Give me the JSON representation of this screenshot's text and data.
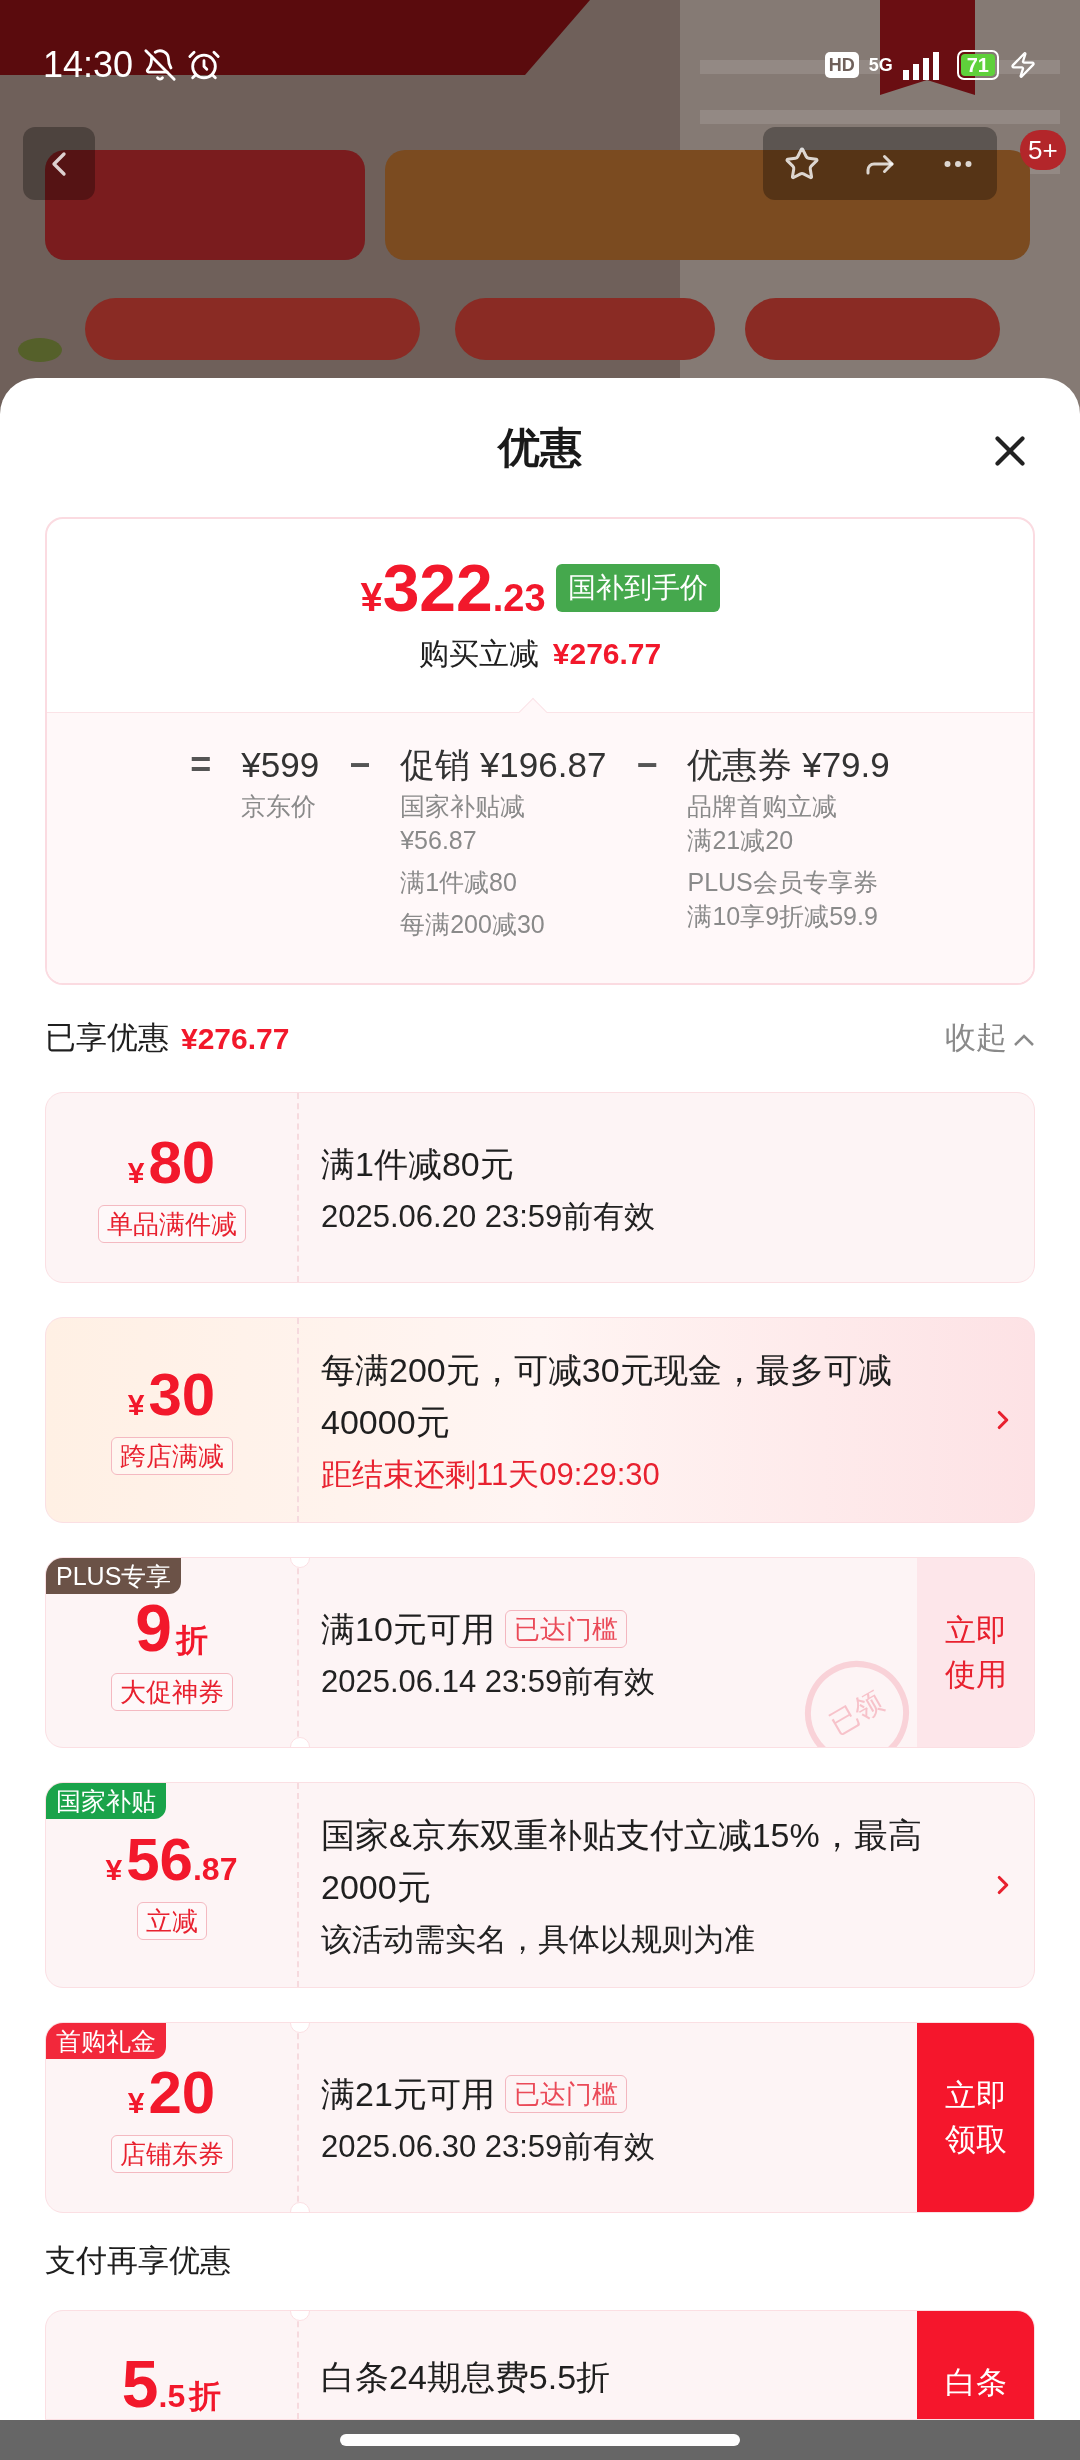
{
  "status_bar": {
    "time": "14:30",
    "hd": "HD",
    "network": "5G",
    "battery": "71"
  },
  "nav": {
    "badge": "5+"
  },
  "sheet": {
    "title": "优惠"
  },
  "summary": {
    "final_price": {
      "currency": "¥",
      "integer": "322",
      "decimal": ".23"
    },
    "price_badge": "国补到手价",
    "reduce_label": "购买立减",
    "reduce_amount": "¥276.77",
    "breakdown": [
      {
        "op": "=",
        "main": "¥599",
        "details": [
          {
            "name": "京东价"
          }
        ]
      },
      {
        "op": "−",
        "main": "促销 ¥196.87",
        "details": [
          {
            "name": "国家补贴减",
            "value": "¥56.87"
          },
          {
            "name": "满1件减80"
          },
          {
            "name": "每满200减30"
          }
        ]
      },
      {
        "op": "−",
        "main": "优惠券 ¥79.9",
        "details": [
          {
            "name": "品牌首购立减",
            "value": "满21减20"
          },
          {
            "name": "PLUS会员专享券",
            "value": "满10享9折减59.9"
          }
        ]
      }
    ]
  },
  "enjoyed": {
    "label": "已享优惠",
    "amount": "¥276.77",
    "toggle": "收起",
    "expanded": true
  },
  "coupons": [
    {
      "kind": "plain",
      "amount": {
        "currency": "¥",
        "integer": "80"
      },
      "label": "单品满件减",
      "title": "满1件减80元",
      "lines": [
        "2025.06.20 23:59前有效"
      ]
    },
    {
      "kind": "promo",
      "amount": {
        "currency": "¥",
        "integer": "30"
      },
      "label": "跨店满减",
      "title": "每满200元，可减30元现金，最多可减40000元",
      "note": "距结束还剩11天09:29:30",
      "chevron": true
    },
    {
      "kind": "ticket",
      "tag": {
        "text": "PLUS专享",
        "color": "#6b5247"
      },
      "amount": {
        "integer": "9",
        "unit": "折"
      },
      "label": "大促神券",
      "title": "满10元可用",
      "badge": "已达门槛",
      "lines": [
        "2025.06.14 23:59前有效"
      ],
      "action": {
        "kind": "outline",
        "text": "立即使用"
      },
      "stamp": "已领"
    },
    {
      "kind": "plain",
      "tag": {
        "text": "国家补贴",
        "color": "#1aa34a"
      },
      "amount": {
        "currency": "¥",
        "integer": "56",
        "decimal": ".87"
      },
      "label": "立减",
      "title": "国家&京东双重补贴支付立减15%，最高2000元",
      "lines": [
        "该活动需实名，具体以规则为准"
      ],
      "chevron": true
    },
    {
      "kind": "ticket",
      "tag": {
        "text": "首购礼金",
        "color": "#f2283b"
      },
      "amount": {
        "currency": "¥",
        "integer": "20"
      },
      "label": "店铺东券",
      "title": "满21元可用",
      "badge": "已达门槛",
      "lines": [
        "2025.06.30 23:59前有效"
      ],
      "action": {
        "kind": "solid",
        "text": "立即领取"
      }
    }
  ],
  "pay_section": {
    "title": "支付再享优惠",
    "coupons": [
      {
        "kind": "ticket",
        "amount": {
          "integer": "5",
          "decimal": ".5",
          "unit": "折"
        },
        "title": "白条24期息费5.5折",
        "action": {
          "kind": "solid",
          "text": "白条"
        }
      }
    ]
  }
}
